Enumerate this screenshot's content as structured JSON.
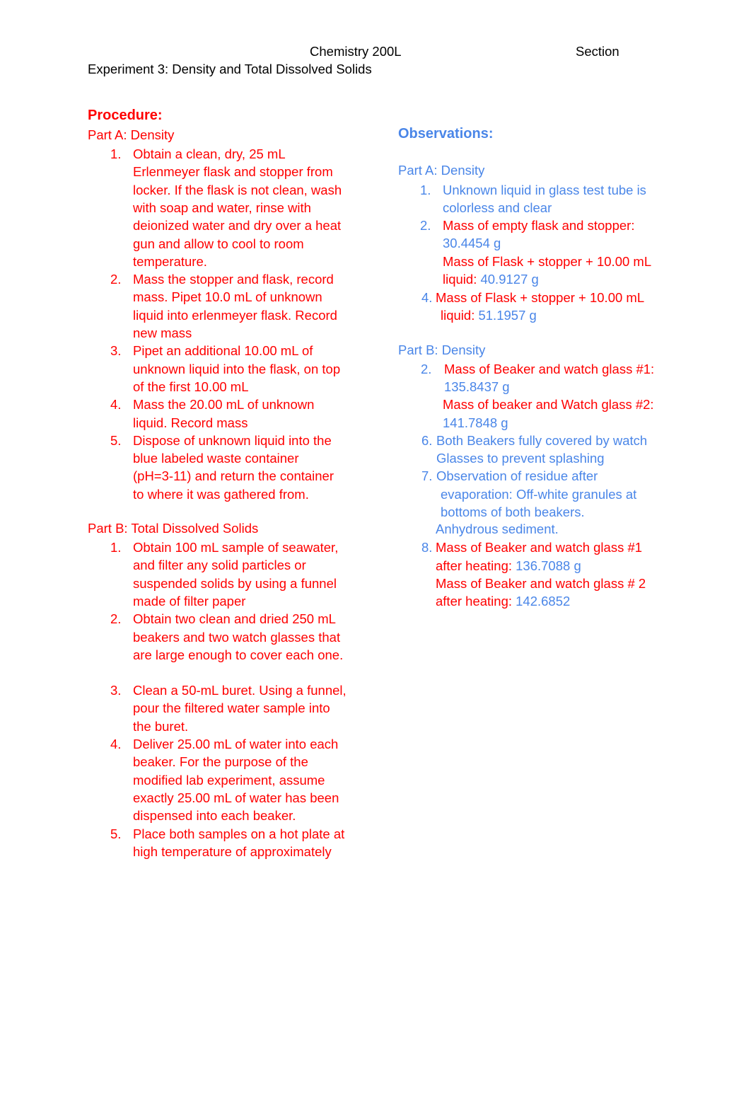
{
  "header": {
    "course": "Chemistry 200L",
    "section_label": "Section",
    "experiment_title": "Experiment 3: Density and Total Dissolved Solids"
  },
  "procedure": {
    "heading": "Procedure:",
    "part_a": {
      "title": "Part A: Density",
      "steps": [
        {
          "num": "1.",
          "lines": [
            "Obtain a clean, dry, 25 mL",
            "Erlenmeyer flask and stopper from",
            "locker. If the flask is not clean, wash",
            "with soap and water, rinse with",
            "deionized water and dry over a heat",
            "gun and allow to cool to room",
            "temperature."
          ]
        },
        {
          "num": "2.",
          "lines": [
            "Mass the stopper and flask, record",
            "mass. Pipet 10.0 mL of unknown",
            "liquid into erlenmeyer flask. Record",
            "new mass"
          ]
        },
        {
          "num": "3.",
          "lines": [
            "Pipet an additional 10.00 mL of",
            "unknown liquid into the flask, on top",
            "of the first 10.00 mL"
          ]
        },
        {
          "num": "4.",
          "lines": [
            "Mass the 20.00 mL of unknown",
            "liquid. Record mass"
          ]
        },
        {
          "num": "5.",
          "lines": [
            "Dispose of unknown liquid into the",
            "blue labeled waste container",
            "(pH=3-11) and return the container",
            "to where it was gathered from."
          ]
        }
      ]
    },
    "part_b": {
      "title": "Part B: Total Dissolved Solids",
      "steps": [
        {
          "num": "1.",
          "lines": [
            "Obtain 100 mL sample of seawater,",
            "and filter any solid particles or",
            "suspended solids by using a funnel",
            "made of filter paper"
          ]
        },
        {
          "num": "2.",
          "lines": [
            "Obtain two clean and dried 250 mL",
            "beakers and two watch glasses that",
            "are large enough to cover each one."
          ]
        },
        {
          "num": "3.",
          "lines": [
            "Clean a 50-mL buret. Using a funnel,",
            "pour the filtered water sample into",
            "the buret."
          ]
        },
        {
          "num": "4.",
          "lines": [
            "Deliver 25.00 mL of water into each",
            "beaker. For the purpose of the",
            "modified lab experiment, assume",
            "exactly 25.00 mL of water has been",
            "dispensed into each beaker."
          ]
        },
        {
          "num": "5.",
          "lines": [
            "Place both samples on a hot plate at",
            "high temperature of approximately"
          ]
        }
      ]
    }
  },
  "observations": {
    "heading": "Observations:",
    "part_a": {
      "title": "Part A: Density",
      "items": [
        {
          "num": "1.",
          "text_lines": [
            "Unknown liquid in glass test tube is",
            "colorless and clear"
          ]
        },
        {
          "num": "2.",
          "label": "Mass of empty flask and stopper:",
          "value": "30.4454 g"
        },
        {
          "label_line1": "Mass of Flask + stopper + 10.00 mL",
          "label_line2": "liquid:",
          "value": "40.9127 g"
        },
        {
          "num": "4.",
          "label_line1": "Mass of Flask + stopper + 10.00 mL",
          "label_line2": "liquid:",
          "value": "51.1957 g"
        }
      ]
    },
    "part_b": {
      "title": "Part B: Density",
      "items": [
        {
          "num": "2.",
          "label": "Mass of Beaker and watch glass #1:",
          "value": "135.8437 g"
        },
        {
          "label": "Mass of beaker and Watch glass #2:",
          "value": "141.7848 g"
        },
        {
          "num": "6.",
          "text_lines": [
            "Both Beakers fully covered by watch",
            "Glasses to prevent splashing"
          ]
        },
        {
          "num": "7.",
          "text_lines": [
            "Observation of residue after",
            "evaporation: Off-white granules at",
            "bottoms of both beakers.",
            "Anhydrous sediment."
          ]
        },
        {
          "num": "8.",
          "label_line1": "Mass of Beaker and watch glass #1",
          "label_line2": "after heating:",
          "value": "136.7088 g"
        },
        {
          "label_line1": "Mass of Beaker and watch glass # 2",
          "label_line2": "after heating:",
          "value": "142.6852"
        }
      ]
    }
  },
  "colors": {
    "procedure_text": "#ff0000",
    "observation_text": "#4a86e8",
    "header_text": "#000000"
  }
}
